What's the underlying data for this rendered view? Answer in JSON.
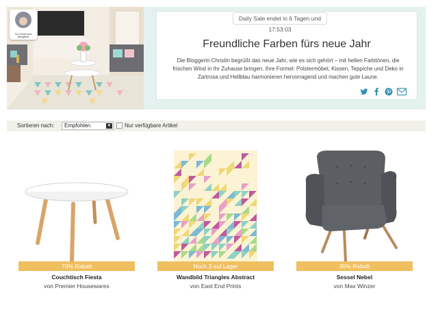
{
  "hero": {
    "avatar_caption": "Do Good feat Wingfield",
    "sale_banner": "Daily Sale endet in 6 Tagen und 17:53:03",
    "title": "Freundliche Farben fürs neue Jahr",
    "text": "Die Bloggerin Christin begrüßt das neue Jahr, wie es sich gehört – mit hellen Farbtönen, die frischen Wind in Ihr Zuhause bringen. Ihre Formel: Polstermöbel, Kissen, Teppiche und Deko in Zartrosa und Hellblau harmonieren hervorragend und machen gute Laune.",
    "share_icons": [
      "twitter-icon",
      "facebook-icon",
      "pinterest-icon",
      "mail-icon"
    ],
    "accent_color": "#2e8fb0",
    "bg_color": "#e4f2ef"
  },
  "sortbar": {
    "label": "Sortieren nach:",
    "selected": "Empfohlen",
    "checkbox_label": "Nur verfügbare Artikel"
  },
  "products": [
    {
      "badge": "70% Rabatt",
      "name": "Couchtisch Fiesta",
      "brand": "von Premier Housewares"
    },
    {
      "badge": "Noch 3 auf Lager",
      "name": "Wandbild Triangles Abstract",
      "brand": "von East End Prints"
    },
    {
      "badge": "35% Rabatt",
      "name": "Sessel Nebel",
      "brand": "von Max Winzer"
    }
  ],
  "colors": {
    "badge": "#efbf60",
    "sortbar": "#f1f1ea"
  }
}
